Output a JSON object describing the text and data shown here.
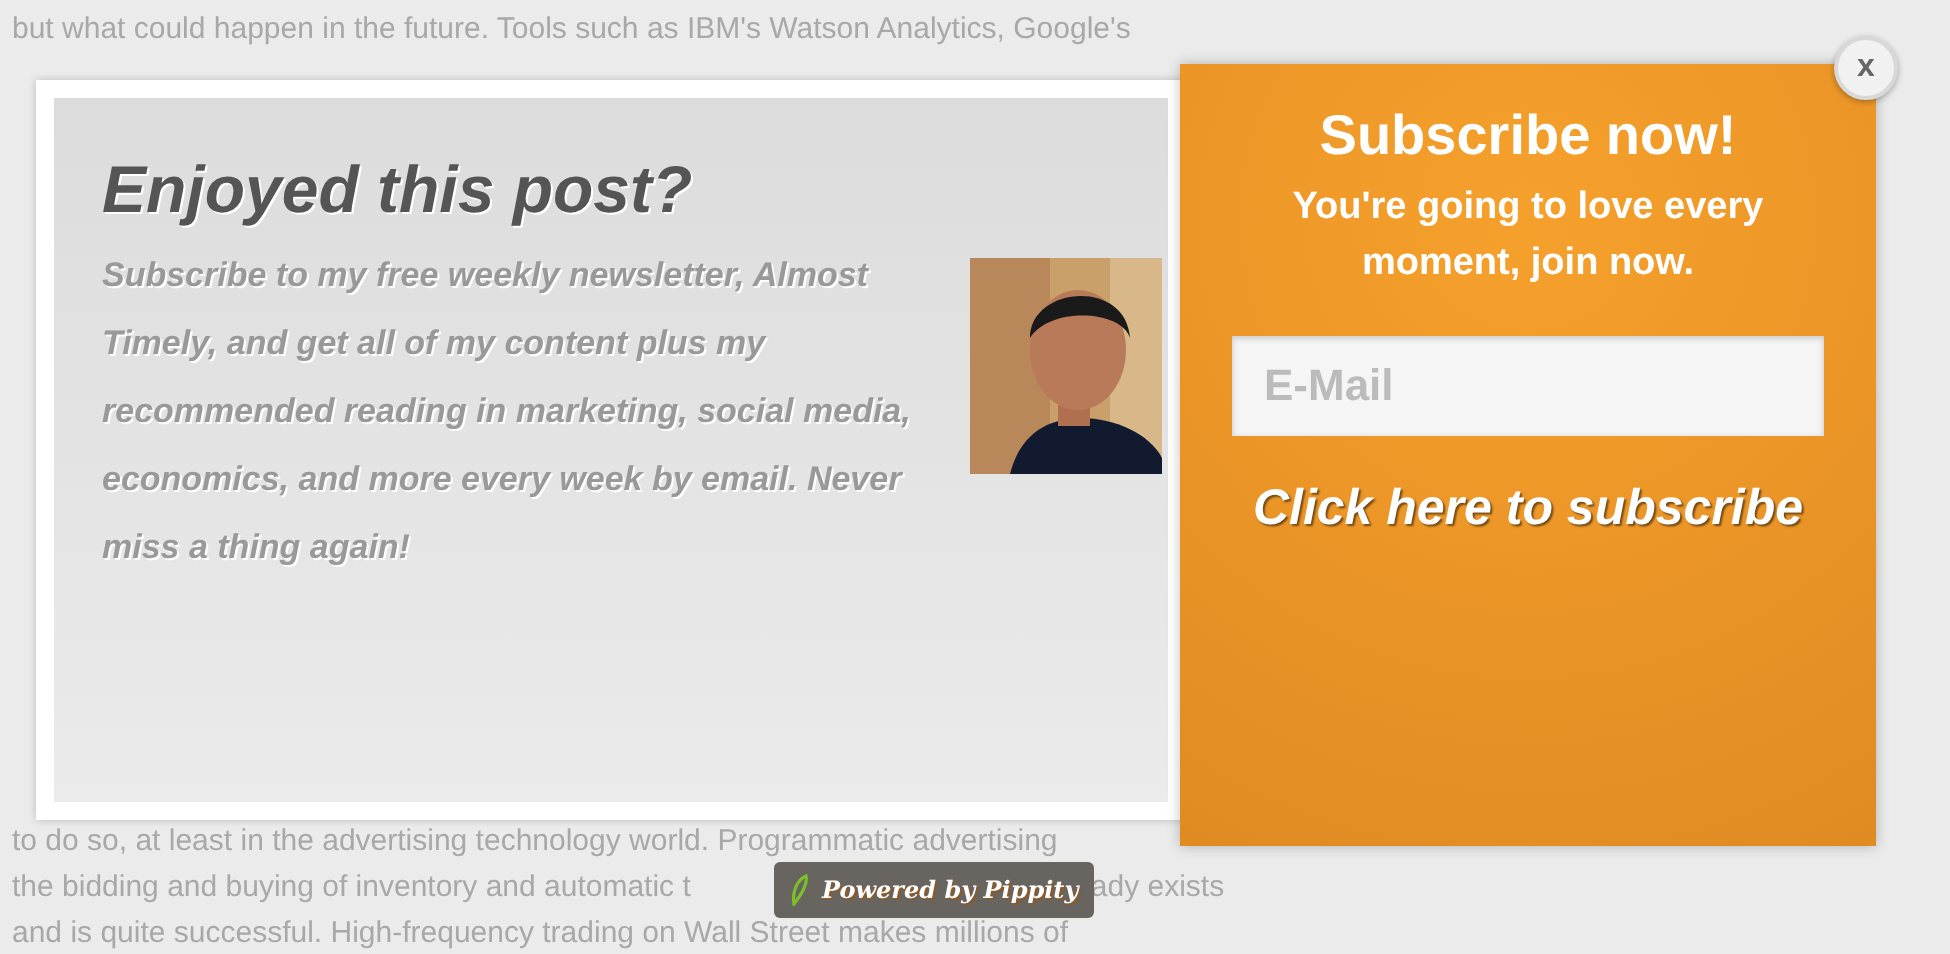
{
  "background_article": {
    "lines": [
      {
        "fragments": [
          "but what could happen in the future. Tools such as IBM's Watson Analytics, Google's"
        ]
      },
      {
        "fragments": [
          "to do so, at least in the advertising technology world. Programmatic advertising"
        ]
      },
      {
        "fragments": [
          "the bidding and buying of inventory and automatic t",
          "ady exists"
        ]
      },
      {
        "fragments": [
          "and is quite successful. High-frequency trading on Wall Street makes millions of"
        ]
      }
    ]
  },
  "popup": {
    "title": "Enjoyed this post?",
    "message": "Subscribe to my free weekly newsletter, Almost Timely, and get all of my content plus my recommended reading in marketing, social media, economics, and more every week by email. Never miss a thing again!",
    "signup": {
      "heading": "Subscribe now!",
      "subheading": "You're going to love every moment, join now.",
      "email_field": {
        "placeholder": "E-Mail"
      },
      "submit": "Click here to subscribe"
    },
    "close": "x"
  },
  "badge": "Powered by Pippity"
}
